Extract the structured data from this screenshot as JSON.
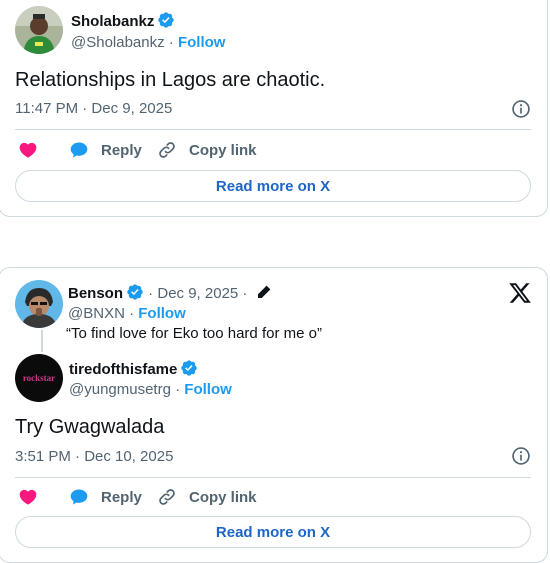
{
  "tweet1": {
    "name": "Sholabankz",
    "handle": "@Sholabankz",
    "follow_label": "Follow",
    "text": "Relationships in Lagos are chaotic.",
    "timestamp": "11:47 PM · Dec 9, 2025",
    "actions": {
      "like_label": "",
      "reply_label": "Reply",
      "copy_label": "Copy link"
    },
    "read_more_label": "Read more on X"
  },
  "tweet2": {
    "parent": {
      "name": "Benson",
      "date": "Dec 9, 2025",
      "handle": "@BNXN",
      "follow_label": "Follow",
      "text": "“To find love for Eko too hard for me o”"
    },
    "reply": {
      "name": "tiredofthisfame",
      "handle": "@yungmusetrg",
      "follow_label": "Follow",
      "text": "Try Gwagwalada",
      "timestamp": "3:51 PM · Dec 10, 2025"
    },
    "actions": {
      "reply_label": "Reply",
      "copy_label": "Copy link"
    },
    "read_more_label": "Read more on X"
  },
  "colors": {
    "like_red": "#f91880",
    "reply_blue": "#1d9bf0",
    "link_blue": "#1d66c9",
    "muted": "#536471"
  },
  "icons": [
    "verified-badge-icon",
    "info-icon",
    "heart-icon",
    "reply-bubble-icon",
    "link-icon",
    "edit-pencil-icon",
    "x-logo-icon"
  ]
}
